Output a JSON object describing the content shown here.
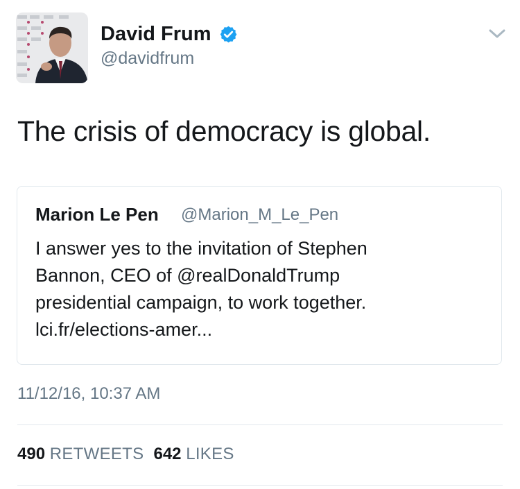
{
  "author": {
    "display_name": "David Frum",
    "handle": "@davidfrum",
    "avatar_icon": "profile-photo",
    "verified_icon": "verified-badge-icon",
    "verified_color": "#1da1f2"
  },
  "menu_icon": "chevron-down-icon",
  "tweet_text": "The crisis of democracy is global.",
  "quoted_tweet": {
    "display_name": "Marion Le Pen",
    "handle": "@Marion_M_Le_Pen",
    "text_lines": [
      "I answer yes to the invitation of Stephen",
      "Bannon, CEO of @realDonaldTrump",
      "presidential campaign, to work together.",
      "lci.fr/elections-amer..."
    ]
  },
  "timestamp": "11/12/16, 10:37 AM",
  "stats": {
    "retweets_count": "490",
    "retweets_label": "RETWEETS",
    "likes_count": "642",
    "likes_label": "LIKES"
  },
  "colors": {
    "text": "#14171a",
    "secondary": "#657786",
    "border": "#e1e8ed"
  }
}
